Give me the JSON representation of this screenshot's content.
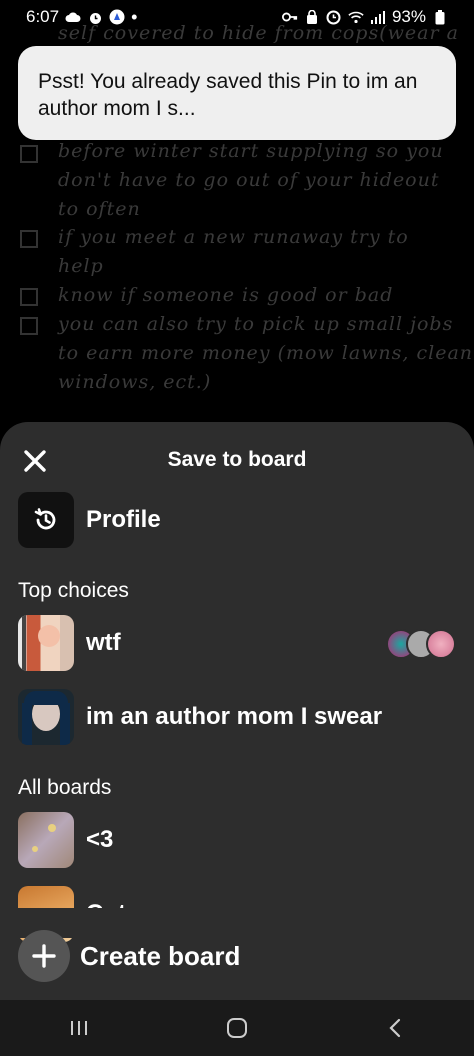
{
  "status_bar": {
    "time": "6:07",
    "battery": "93%"
  },
  "background_pin": {
    "lines": [
      "self covered to hide from cops(wear a",
      "before winter start supplying so you",
      "don't have to go out of your hideout",
      "to often",
      "if you meet a new runaway try to",
      "help",
      "know if someone is good or bad",
      "you can also try to pick up small jobs",
      "to earn more money (mow lawns, clean",
      "windows, ect.)"
    ]
  },
  "toast": {
    "message": "Psst! You already saved this Pin to im an author mom I s..."
  },
  "sheet": {
    "title": "Save to board",
    "profile_label": "Profile",
    "top_choices_label": "Top choices",
    "top_choices": [
      {
        "name": "wtf"
      },
      {
        "name": "im an author mom I swear"
      }
    ],
    "all_boards_label": "All boards",
    "all_boards": [
      {
        "name": "<3"
      },
      {
        "name": "Cute"
      }
    ],
    "create_board_label": "Create board"
  },
  "colors": {
    "sheet_bg": "#2d2d2d",
    "toast_bg": "#efefef",
    "nav_bg": "#1a1a1a"
  }
}
